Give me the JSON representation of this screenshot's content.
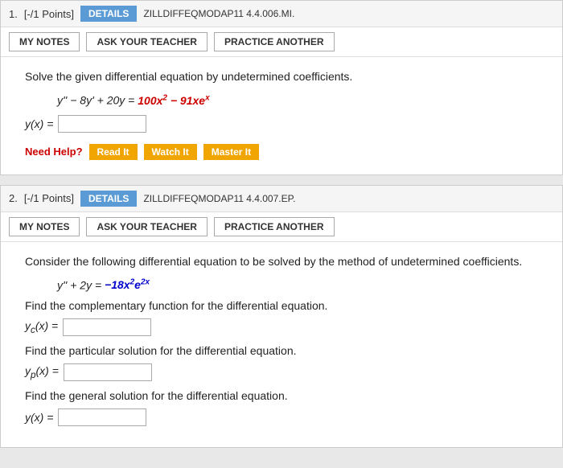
{
  "problems": [
    {
      "number": "1.",
      "points": "[-/1 Points]",
      "details_label": "DETAILS",
      "code": "ZILLDIFFEQMODAP11 4.4.006.MI.",
      "my_notes": "MY NOTES",
      "ask_teacher": "ASK YOUR TEACHER",
      "practice_another": "PRACTICE ANOTHER",
      "description": "Solve the given differential equation by undetermined coefficients.",
      "equation_html": "y'' − 8y' + 20y = 100x² − 91xe^x",
      "answer_label": "y(x) =",
      "need_help": "Need Help?",
      "help_buttons": [
        "Read It",
        "Watch It",
        "Master It"
      ]
    },
    {
      "number": "2.",
      "points": "[-/1 Points]",
      "details_label": "DETAILS",
      "code": "ZILLDIFFEQMODAP11 4.4.007.EP.",
      "my_notes": "MY NOTES",
      "ask_teacher": "ASK YOUR TEACHER",
      "practice_another": "PRACTICE ANOTHER",
      "description": "Consider the following differential equation to be solved by the method of undetermined coefficients.",
      "equation_html": "y'' + 2y = −18x²e^(2x)",
      "sub_questions": [
        {
          "text": "Find the complementary function for the differential equation.",
          "answer_label": "y_c(x) ="
        },
        {
          "text": "Find the particular solution for the differential equation.",
          "answer_label": "y_p(x) ="
        },
        {
          "text": "Find the general solution for the differential equation.",
          "answer_label": "y(x) ="
        }
      ]
    }
  ]
}
